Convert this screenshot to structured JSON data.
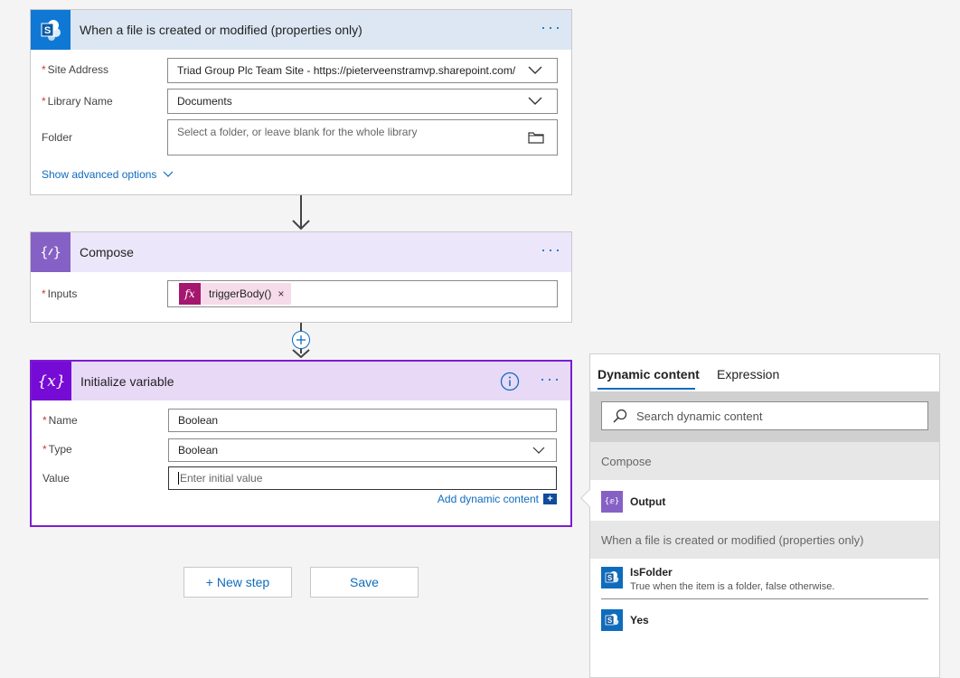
{
  "trigger_card": {
    "title": "When a file is created or modified (properties only)",
    "icon": "sharepoint-icon",
    "site_address_label": "Site Address",
    "site_address_value": "Triad Group Plc Team Site - https://pieterveenstramvp.sharepoint.com/",
    "library_label": "Library Name",
    "library_value": "Documents",
    "folder_label": "Folder",
    "folder_placeholder": "Select a folder, or leave blank for the whole library",
    "advanced_link": "Show advanced options",
    "required_mark": "*"
  },
  "compose_card": {
    "title": "Compose",
    "icon": "compose-icon",
    "inputs_label": "Inputs",
    "token_text": "triggerBody()",
    "token_icon": "fx",
    "token_remove": "×",
    "required_mark": "*"
  },
  "init_card": {
    "title": "Initialize variable",
    "icon_glyph": "{x}",
    "name_label": "Name",
    "name_value": "Boolean",
    "type_label": "Type",
    "type_value": "Boolean",
    "value_label": "Value",
    "value_placeholder": "Enter initial value",
    "add_dynamic_link": "Add dynamic content",
    "required_mark": "*"
  },
  "buttons": {
    "new_step": "+ New step",
    "save": "Save"
  },
  "dynamic_panel": {
    "tabs": [
      "Dynamic content",
      "Expression"
    ],
    "search_placeholder": "Search dynamic content",
    "sections": [
      {
        "title": "Compose",
        "items": [
          {
            "title": "Output",
            "description": "",
            "icon": "compose-icon"
          }
        ]
      },
      {
        "title": "When a file is created or modified (properties only)",
        "items": [
          {
            "title": "IsFolder",
            "description": "True when the item is a folder, false otherwise.",
            "icon": "sharepoint-icon"
          },
          {
            "title": "Yes",
            "description": "",
            "icon": "sharepoint-icon"
          }
        ]
      }
    ]
  },
  "colors": {
    "accent": "#0f6cbd",
    "sharepoint": "#0078d4",
    "compose": "#8661c5",
    "variable": "#770bd6",
    "token": "#a4176e"
  }
}
